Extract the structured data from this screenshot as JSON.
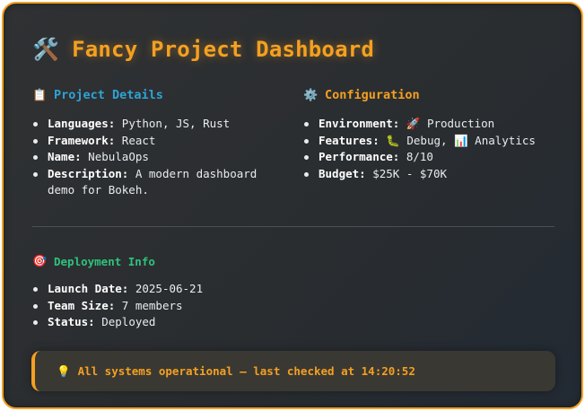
{
  "title": "Fancy Project Dashboard",
  "title_icon": "🛠️",
  "project": {
    "heading_icon": "📋",
    "heading": "Project Details",
    "items": [
      {
        "key": "Languages:",
        "value": "Python, JS, Rust"
      },
      {
        "key": "Framework:",
        "value": "React"
      },
      {
        "key": "Name:",
        "value": "NebulaOps"
      },
      {
        "key": "Description:",
        "value": "A modern dashboard demo for Bokeh."
      }
    ]
  },
  "configuration": {
    "heading_icon": "⚙️",
    "heading": "Configuration",
    "environment": {
      "key": "Environment:",
      "icon": "🚀",
      "value": "Production"
    },
    "features": {
      "key": "Features:",
      "icon1": "🐛",
      "value1": "Debug,",
      "icon2": "📊",
      "value2": "Analytics"
    },
    "performance": {
      "key": "Performance:",
      "value": "8/10"
    },
    "budget": {
      "key": "Budget:",
      "value": "$25K - $70K"
    }
  },
  "deployment": {
    "heading_icon": "🎯",
    "heading": "Deployment Info",
    "items": [
      {
        "key": "Launch Date:",
        "value": "2025-06-21"
      },
      {
        "key": "Team Size:",
        "value": "7 members"
      },
      {
        "key": "Status:",
        "value": "Deployed"
      }
    ]
  },
  "status": {
    "icon": "💡",
    "text": "All systems operational — last checked at 14:20:52"
  },
  "colors": {
    "accent": "#f5a021",
    "project_heading": "#2fa3d6",
    "deployment_heading": "#2ec27e"
  }
}
